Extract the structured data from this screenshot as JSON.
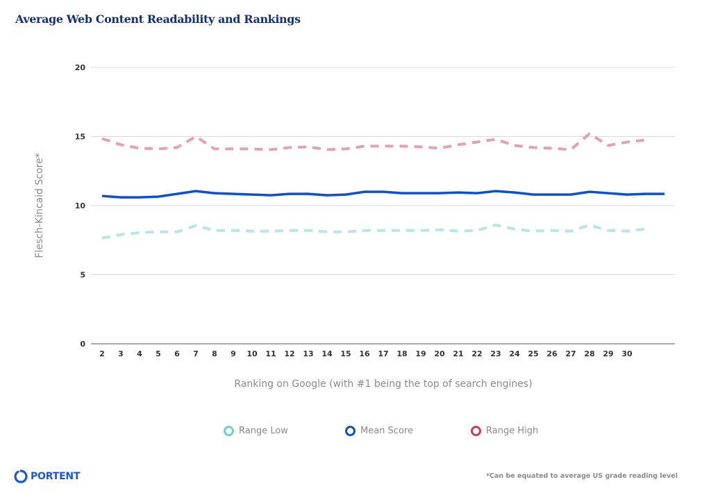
{
  "chart_data": {
    "type": "line",
    "title": "Average Web Content Readability and Rankings",
    "xlabel": "Ranking on Google (with #1 being the top of search engines)",
    "ylabel": "Flesch-Kincaid Score*",
    "ylim": [
      0,
      20
    ],
    "yticks": [
      0,
      5,
      10,
      15,
      20
    ],
    "grid": true,
    "legend_position": "bottom",
    "x": [
      2,
      3,
      4,
      5,
      6,
      7,
      8,
      9,
      10,
      11,
      12,
      13,
      14,
      15,
      16,
      17,
      18,
      19,
      20,
      21,
      22,
      23,
      24,
      25,
      26,
      27,
      28,
      29,
      30,
      31,
      32
    ],
    "xtick_labels": [
      "2",
      "3",
      "4",
      "5",
      "6",
      "7",
      "8",
      "9",
      "10",
      "11",
      "12",
      "13",
      "14",
      "15",
      "16",
      "17",
      "18",
      "19",
      "20",
      "21",
      "22",
      "23",
      "24",
      "25",
      "26",
      "27",
      "28",
      "29",
      "30"
    ],
    "series": [
      {
        "name": "Range Low",
        "color": "#b7e6e3",
        "legend_color": "#6fd1c6",
        "style": "dashed",
        "values": [
          7.65,
          7.9,
          8.05,
          8.1,
          8.1,
          8.55,
          8.2,
          8.2,
          8.15,
          8.15,
          8.2,
          8.2,
          8.1,
          8.1,
          8.2,
          8.2,
          8.2,
          8.2,
          8.25,
          8.15,
          8.2,
          8.6,
          8.3,
          8.15,
          8.2,
          8.15,
          8.6,
          8.2,
          8.15,
          8.3,
          null
        ]
      },
      {
        "name": "Mean Score",
        "color": "#0b4fd6",
        "legend_color": "#0b4fd6",
        "style": "solid",
        "values": [
          10.7,
          10.6,
          10.6,
          10.65,
          10.85,
          11.05,
          10.9,
          10.85,
          10.8,
          10.75,
          10.85,
          10.85,
          10.75,
          10.8,
          11.0,
          11.0,
          10.9,
          10.9,
          10.9,
          10.95,
          10.9,
          11.05,
          10.95,
          10.8,
          10.8,
          10.8,
          11.0,
          10.9,
          10.8,
          10.85,
          10.85
        ]
      },
      {
        "name": "Range High",
        "color": "#e6a0ae",
        "legend_color": "#cc3d5c",
        "style": "dashed",
        "values": [
          14.85,
          14.4,
          14.15,
          14.1,
          14.2,
          15.0,
          14.1,
          14.1,
          14.1,
          14.05,
          14.2,
          14.25,
          14.05,
          14.1,
          14.3,
          14.3,
          14.3,
          14.25,
          14.15,
          14.4,
          14.6,
          14.8,
          14.35,
          14.2,
          14.15,
          14.05,
          15.2,
          14.35,
          14.6,
          14.75,
          null
        ]
      }
    ]
  },
  "branding": {
    "logo_text": "PORTENT",
    "logo_color": "#1a56db"
  },
  "footnote": "*Can be equated to average US grade reading level"
}
